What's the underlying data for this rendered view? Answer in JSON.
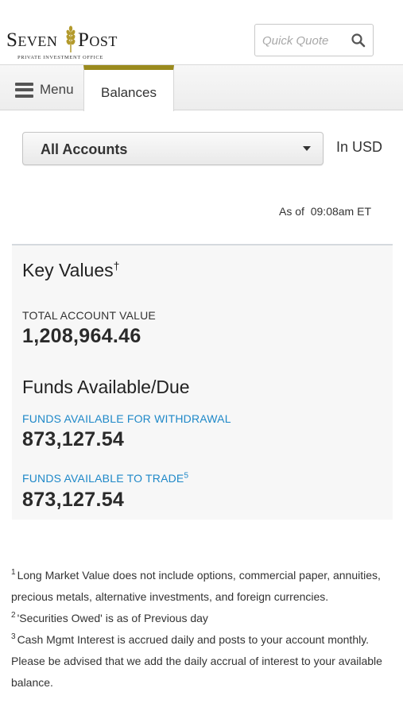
{
  "brand": {
    "name_left": "Seven",
    "name_right": "Post",
    "tagline": "PRIVATE INVESTMENT OFFICE",
    "wheat_color": "#b39a2c"
  },
  "search": {
    "placeholder": "Quick Quote",
    "icon": "search-icon"
  },
  "nav": {
    "menu_label": "Menu",
    "active_tab": "Balances",
    "accent_color": "#9a8a1e"
  },
  "account": {
    "selected": "All Accounts",
    "currency": "In USD",
    "as_of": "As of  09:08am ET"
  },
  "key_values": {
    "title": "Key Values",
    "title_mark": "†",
    "total_account_value_label": "TOTAL ACCOUNT VALUE",
    "total_account_value": "1,208,964.46"
  },
  "funds": {
    "title": "Funds Available/Due",
    "withdrawal_label": "FUNDS AVAILABLE FOR WITHDRAWAL",
    "withdrawal_value": "873,127.54",
    "trade_label": "FUNDS AVAILABLE TO TRADE",
    "trade_note": "5",
    "trade_value": "873,127.54",
    "label_color": "#1e88c8"
  },
  "footnotes": [
    {
      "num": "1",
      "text": "Long Market Value does not include options, commercial paper, annuities, precious metals, alternative investments, and foreign currencies."
    },
    {
      "num": "2",
      "text": "'Securities Owed' is as of Previous day"
    },
    {
      "num": "3",
      "text": "Cash Mgmt Interest is accrued daily and posts to your account monthly. Please be advised that we add the daily accrual of interest to your available balance."
    }
  ]
}
